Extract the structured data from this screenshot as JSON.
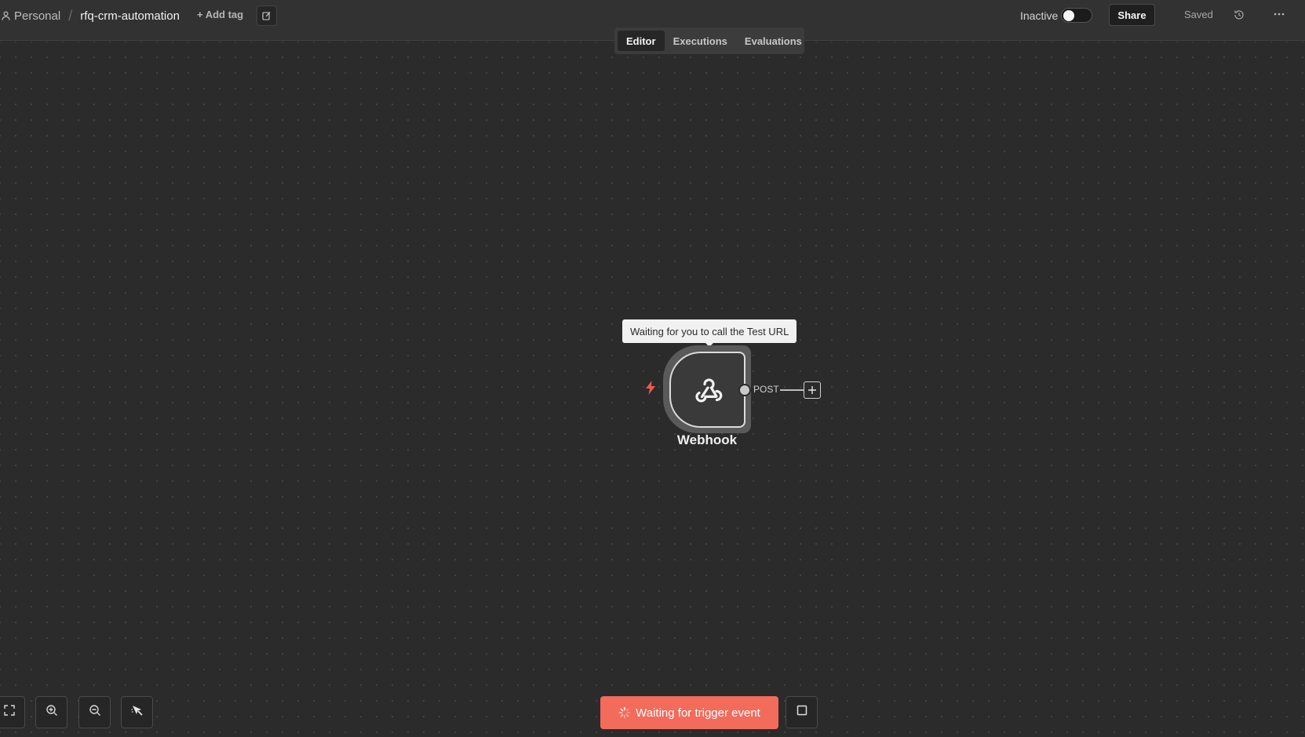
{
  "header": {
    "breadcrumb_root": "Personal",
    "breadcrumb_separator": "/",
    "workflow_name": "rfq-crm-automation",
    "add_tag": "+ Add tag",
    "status_label": "Inactive",
    "share_label": "Share",
    "saved_label": "Saved",
    "icons": [
      "person-icon",
      "edit-icon",
      "history-icon",
      "more-icon"
    ]
  },
  "tabs": [
    {
      "label": "Editor",
      "active": true
    },
    {
      "label": "Executions",
      "active": false
    },
    {
      "label": "Evaluations",
      "active": false
    }
  ],
  "canvas": {
    "tooltip": "Waiting for you to call the Test URL",
    "node": {
      "label": "Webhook",
      "icon": "webhook-icon",
      "trigger_icon": "lightning-bolt-icon",
      "output_label": "POST"
    }
  },
  "controls": {
    "fit_view_icon": "fit-view-icon",
    "zoom_in_icon": "zoom-in-icon",
    "zoom_out_icon": "zoom-out-icon",
    "tidy_up_icon": "tidy-up-icon",
    "trigger_button_label": "Waiting for trigger event",
    "stop_icon": "stop-icon"
  },
  "colors": {
    "accent": "#f26b5b",
    "canvas_bg": "#2b2b2b",
    "header_bg": "#323232"
  }
}
